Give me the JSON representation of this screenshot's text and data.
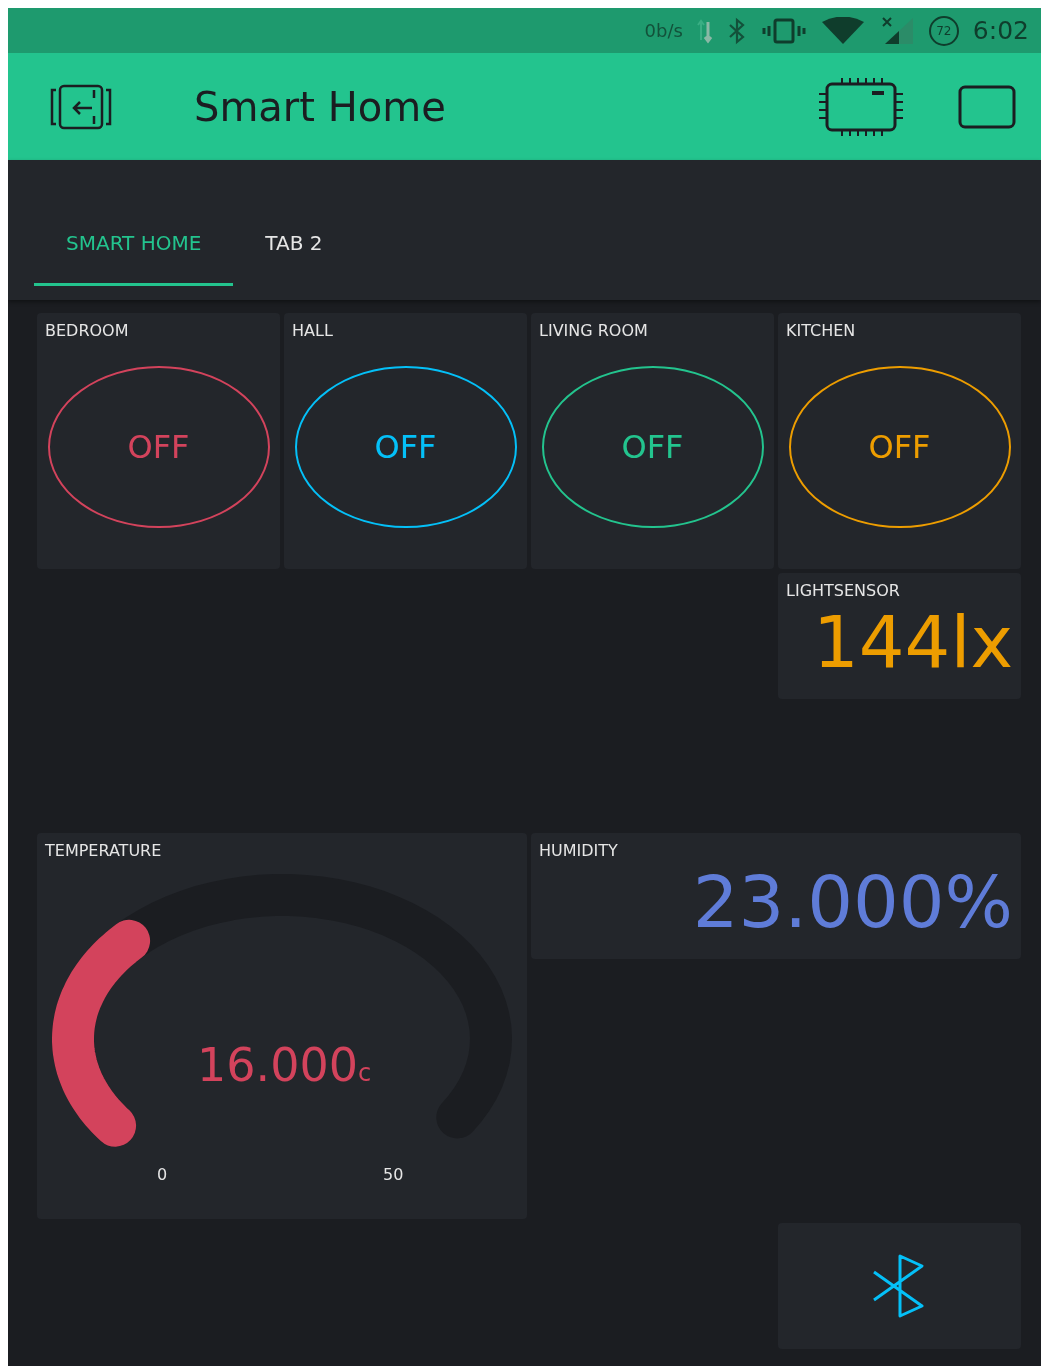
{
  "status_bar": {
    "speed": "0b/s",
    "battery": "72",
    "time": "6:02"
  },
  "app_bar": {
    "title": "Smart Home"
  },
  "tabs": [
    {
      "label": "SMART HOME",
      "selected": true
    },
    {
      "label": "TAB 2",
      "selected": false
    }
  ],
  "widgets": [
    {
      "kind": "button",
      "label": "BEDROOM",
      "text": "OFF",
      "on": false,
      "color": "#d3435c"
    },
    {
      "kind": "button",
      "label": "HALL",
      "text": "OFF",
      "on": false,
      "color": "#04c0f8"
    },
    {
      "kind": "button",
      "label": "LIVING ROOM",
      "text": "OFF",
      "on": false,
      "color": "#23c48e"
    },
    {
      "kind": "button",
      "label": "KITCHEN",
      "text": "OFF",
      "on": false,
      "color": "#ed9d00"
    },
    {
      "kind": "display",
      "label": "LIGHTSENSOR",
      "value": "144lx",
      "color": "#ed9d00"
    },
    {
      "kind": "gauge",
      "label": "TEMPERATURE",
      "value": "16.000$_{c}$",
      "min": "0",
      "max": "50",
      "color": "#d3435c"
    },
    {
      "kind": "display",
      "label": "HUMIDITY",
      "value": "23.000%",
      "color": "#5f7cd8"
    },
    {
      "kind": "bluetooth",
      "color": "#04c0f8"
    }
  ]
}
